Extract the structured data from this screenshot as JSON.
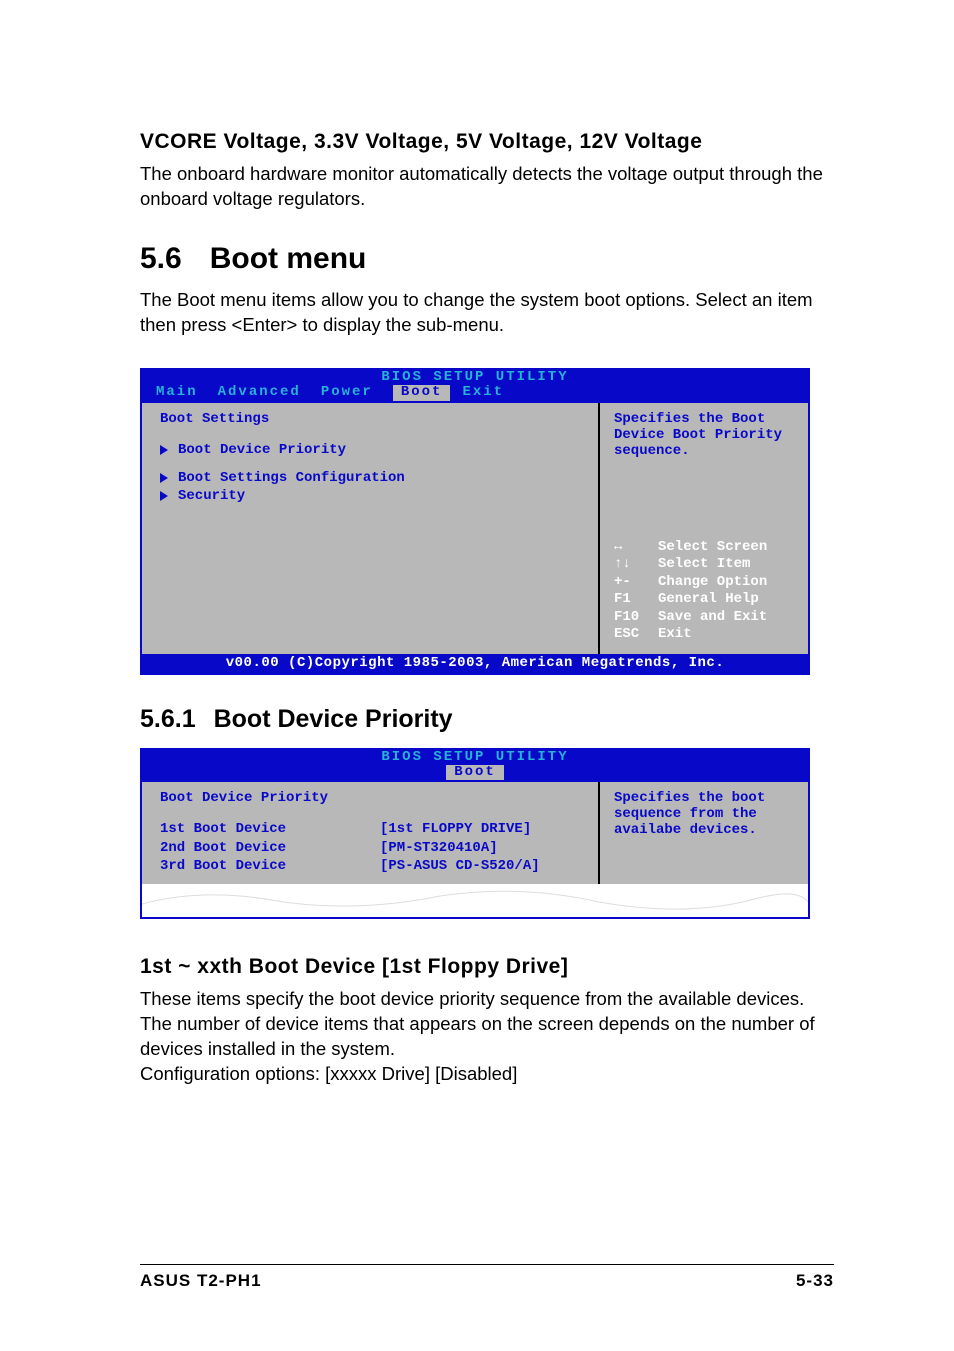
{
  "section_voltage": {
    "heading": "VCORE Voltage, 3.3V Voltage, 5V Voltage, 12V Voltage",
    "text": "The onboard hardware monitor automatically detects the voltage output through the onboard voltage regulators."
  },
  "section_boot": {
    "number": "5.6",
    "title": "Boot menu",
    "text": "The Boot menu items allow you to change the system boot options. Select an item then press <Enter> to display the sub-menu."
  },
  "bios1": {
    "header": "BIOS SETUP UTILITY",
    "tabs": [
      "Main",
      "Advanced",
      "Power",
      "Boot",
      "Exit"
    ],
    "active_tab": "Boot",
    "left_title": "Boot Settings",
    "items": [
      "Boot Device Priority",
      "Boot Settings Configuration",
      "Security"
    ],
    "right_help": "Specifies the Boot Device Boot Priority sequence.",
    "keys": [
      {
        "k": "↔",
        "d": "Select Screen"
      },
      {
        "k": "↑↓",
        "d": "Select Item"
      },
      {
        "k": "+-",
        "d": "Change Option"
      },
      {
        "k": "F1",
        "d": "General Help"
      },
      {
        "k": "F10",
        "d": "Save and Exit"
      },
      {
        "k": "ESC",
        "d": "Exit"
      }
    ],
    "footer": "v00.00 (C)Copyright 1985-2003, American Megatrends, Inc."
  },
  "section_bdp": {
    "number": "5.6.1",
    "title": "Boot Device Priority"
  },
  "bios2": {
    "header": "BIOS SETUP UTILITY",
    "active_tab": "Boot",
    "left_title": "Boot Device Priority",
    "fields": [
      {
        "name": "1st Boot Device",
        "value": "[1st FLOPPY DRIVE]"
      },
      {
        "name": "2nd Boot Device",
        "value": "[PM-ST320410A]"
      },
      {
        "name": "3rd Boot Device",
        "value": "[PS-ASUS CD-S520/A]"
      }
    ],
    "right_help": "Specifies the boot sequence from the availabe devices."
  },
  "section_xxth": {
    "heading": "1st ~ xxth Boot Device [1st Floppy Drive]",
    "p1": "These items specify the boot device priority sequence from the available devices. The number of device items that appears on the screen depends on the number of devices installed in the system.",
    "p2": "Configuration options: [xxxxx Drive] [Disabled]"
  },
  "page_footer": {
    "left": "ASUS T2-PH1",
    "right": "5-33"
  }
}
